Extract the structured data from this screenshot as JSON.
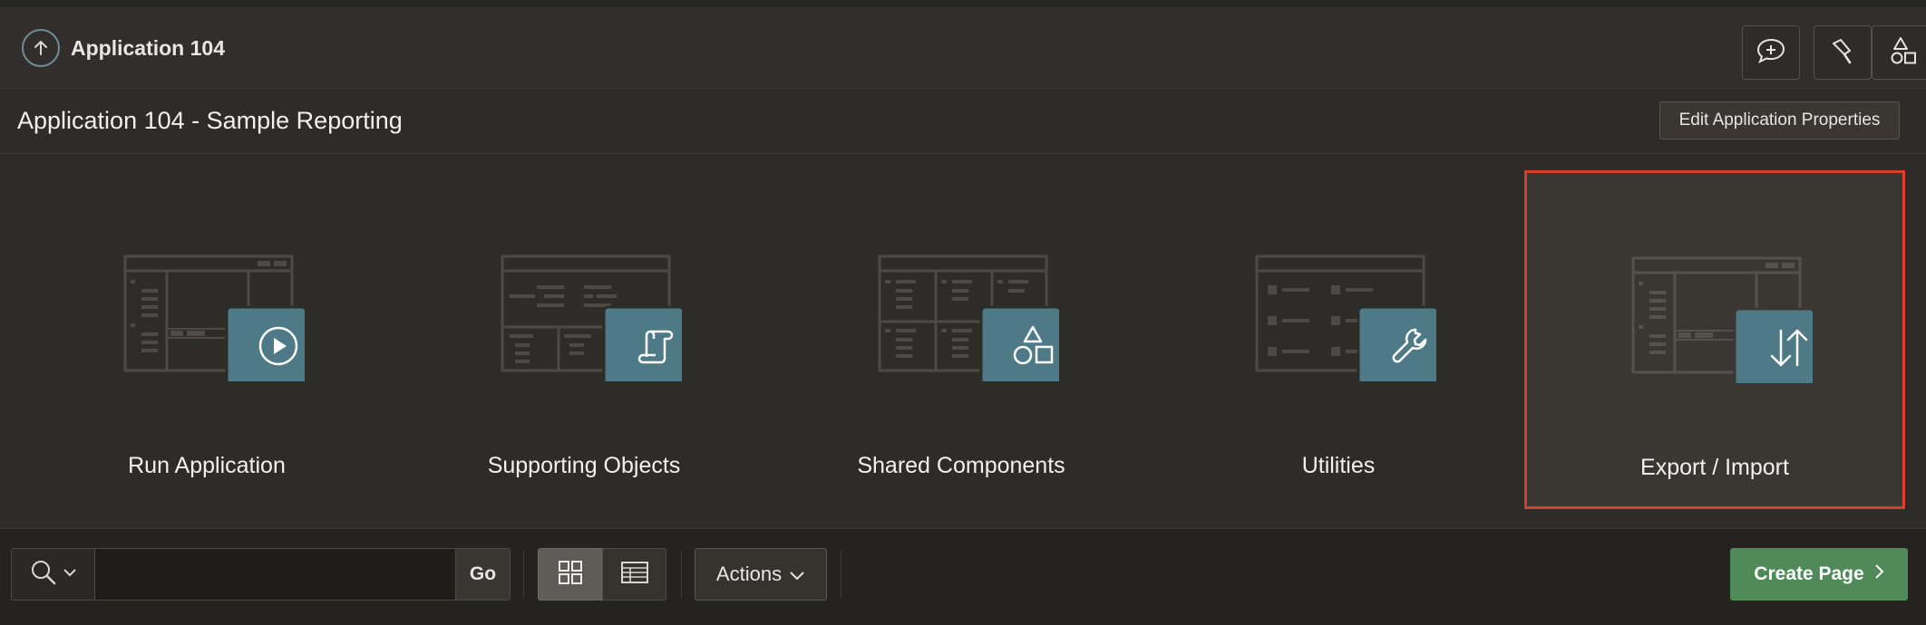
{
  "header": {
    "app_title": "Application 104",
    "icons": [
      "up-arrow-icon",
      "chat-plus-icon",
      "flashlight-icon",
      "shapes-icon"
    ]
  },
  "titlebar": {
    "title": "Application 104 - Sample Reporting",
    "edit_label": "Edit Application Properties"
  },
  "tiles": [
    {
      "label": "Run Application",
      "icon": "play-icon",
      "selected": false
    },
    {
      "label": "Supporting Objects",
      "icon": "scroll-icon",
      "selected": false
    },
    {
      "label": "Shared Components",
      "icon": "shapes-icon",
      "selected": false
    },
    {
      "label": "Utilities",
      "icon": "wrench-icon",
      "selected": false
    },
    {
      "label": "Export / Import",
      "icon": "up-down-arrows-icon",
      "selected": true
    }
  ],
  "toolbar": {
    "search_value": "",
    "go_label": "Go",
    "actions_label": "Actions",
    "create_label": "Create Page"
  },
  "colors": {
    "accent_tile": "#4e7a88",
    "selected_border": "#d9402b",
    "create_button": "#4f8a58"
  }
}
